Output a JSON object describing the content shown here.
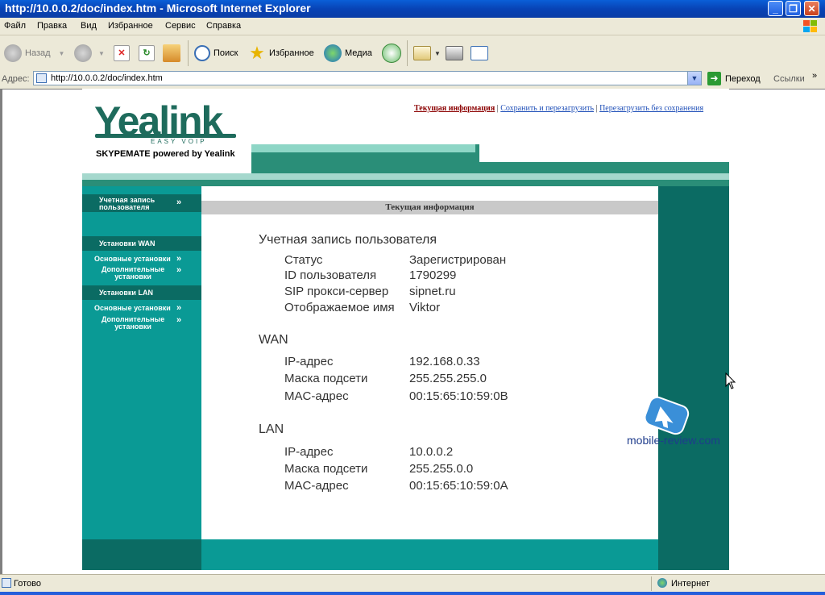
{
  "window": {
    "title": "http://10.0.0.2/doc/index.htm - Microsoft Internet Explorer"
  },
  "menu": [
    "Файл",
    "Правка",
    "Вид",
    "Избранное",
    "Сервис",
    "Справка"
  ],
  "toolbar": {
    "back": "Назад",
    "search": "Поиск",
    "favorites": "Избранное",
    "media": "Медиа"
  },
  "address": {
    "label": "Адрес:",
    "url": "http://10.0.0.2/doc/index.htm",
    "go": "Переход",
    "links": "Ссылки"
  },
  "device": {
    "logo": "Yealink",
    "tagline": "EASY VOIP",
    "skypemate": "SKYPEMATE powered by Yealink",
    "top_links": {
      "current": "Текущая информация",
      "save_reboot": "Сохранить и перезагрузить",
      "reboot_nosave": "Перезагрузить без сохранения"
    },
    "sidebar": {
      "account_l1": "Учетная запись",
      "account_l2": "пользователя",
      "wan_title": "Установки WAN",
      "wan_basic": "Основные установки",
      "wan_adv_l1": "Дополнительные",
      "wan_adv_l2": "установки",
      "lan_title": "Установки LAN",
      "lan_basic": "Основные установки",
      "lan_adv_l1": "Дополнительные",
      "lan_adv_l2": "установки"
    },
    "content_title": "Текущая информация",
    "account": {
      "heading": "Учетная запись пользователя",
      "rows": [
        {
          "k": "Статус",
          "v": "Зарегистрирован"
        },
        {
          "k": "ID пользователя",
          "v": "1790299"
        },
        {
          "k": "SIP прокси-сервер",
          "v": "sipnet.ru"
        },
        {
          "k": "Отображаемое имя",
          "v": "Viktor"
        }
      ]
    },
    "wan": {
      "heading": "WAN",
      "rows": [
        {
          "k": "IP-адрес",
          "v": "192.168.0.33"
        },
        {
          "k": "Маска подсети",
          "v": "255.255.255.0"
        },
        {
          "k": "MAC-адрес",
          "v": "00:15:65:10:59:0B"
        }
      ]
    },
    "lan": {
      "heading": "LAN",
      "rows": [
        {
          "k": "IP-адрес",
          "v": "10.0.0.2"
        },
        {
          "k": "Маска подсети",
          "v": "255.255.0.0"
        },
        {
          "k": "MAC-адрес",
          "v": "00:15:65:10:59:0A"
        }
      ]
    }
  },
  "watermark": "mobile-review.com",
  "status": {
    "text": "Готово",
    "zone": "Интернет"
  },
  "colors": {
    "teal": "#0a9a95",
    "dark_teal": "#0b6b63",
    "logo_green": "#1e6b5c",
    "xp_blue": "#0843b5"
  }
}
